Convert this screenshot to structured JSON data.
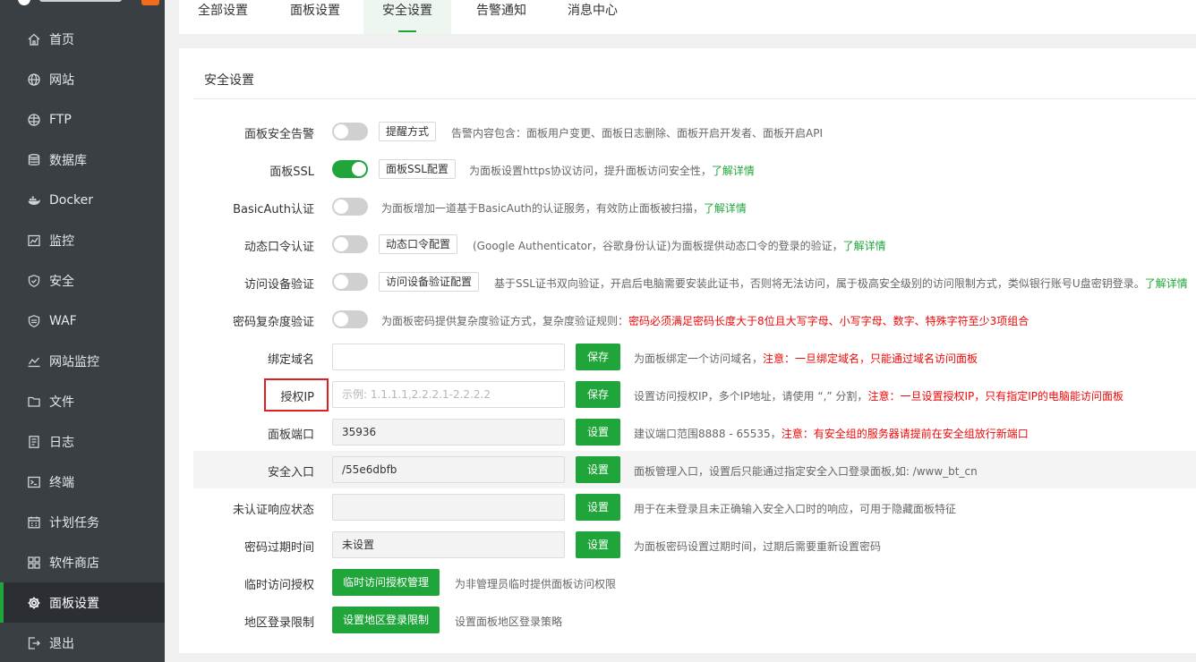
{
  "sidebar": {
    "items": [
      {
        "label": "首页",
        "icon": "home-icon"
      },
      {
        "label": "网站",
        "icon": "globe-icon"
      },
      {
        "label": "FTP",
        "icon": "ftp-globe-icon"
      },
      {
        "label": "数据库",
        "icon": "database-icon"
      },
      {
        "label": "Docker",
        "icon": "docker-icon"
      },
      {
        "label": "监控",
        "icon": "monitor-chart-icon"
      },
      {
        "label": "安全",
        "icon": "shield-check-icon"
      },
      {
        "label": "WAF",
        "icon": "waf-shield-icon"
      },
      {
        "label": "网站监控",
        "icon": "line-chart-icon"
      },
      {
        "label": "文件",
        "icon": "folder-icon"
      },
      {
        "label": "日志",
        "icon": "log-icon"
      },
      {
        "label": "终端",
        "icon": "terminal-icon"
      },
      {
        "label": "计划任务",
        "icon": "calendar-icon"
      },
      {
        "label": "软件商店",
        "icon": "grid-icon"
      },
      {
        "label": "面板设置",
        "icon": "gear-icon",
        "active": true
      },
      {
        "label": "退出",
        "icon": "logout-icon"
      }
    ]
  },
  "tabs": [
    {
      "label": "全部设置"
    },
    {
      "label": "面板设置"
    },
    {
      "label": "安全设置",
      "active": true
    },
    {
      "label": "告警通知"
    },
    {
      "label": "消息中心"
    }
  ],
  "panel": {
    "title": "安全设置",
    "rows": {
      "alert": {
        "label": "面板安全告警",
        "button": "提醒方式",
        "desc": "告警内容包含：面板用户变更、面板日志删除、面板开启开发者、面板开启API"
      },
      "ssl": {
        "label": "面板SSL",
        "button": "面板SSL配置",
        "desc": "为面板设置https协议访问，提升面板访问安全性，",
        "link": "了解详情"
      },
      "basicauth": {
        "label": "BasicAuth认证",
        "desc": "为面板增加一道基于BasicAuth的认证服务，有效防止面板被扫描，",
        "link": "了解详情"
      },
      "otp": {
        "label": "动态口令认证",
        "button": "动态口令配置",
        "desc": "(Google Authenticator，谷歌身份认证)为面板提供动态口令的登录的验证，",
        "link": "了解详情"
      },
      "device": {
        "label": "访问设备验证",
        "button": "访问设备验证配置",
        "desc": "基于SSL证书双向验证，开启后电脑需要安装此证书，否则将无法访问，属于极高安全级别的访问限制方式，类似银行账号U盘密钥登录。",
        "link": "了解详情"
      },
      "pwdcomplex": {
        "label": "密码复杂度验证",
        "desc": "为面板密码提供复杂度验证方式，复杂度验证规则：",
        "warn": "密码必须满足密码长度大于8位且大写字母、小写字母、数字、特殊字符至少3项组合"
      },
      "domain": {
        "label": "绑定域名",
        "value": "",
        "button": "保存",
        "desc": "为面板绑定一个访问域名，",
        "warn": "注意：一旦绑定域名，只能通过域名访问面板"
      },
      "ip": {
        "label": "授权IP",
        "placeholder": "示例: 1.1.1.1,2.2.2.1-2.2.2.2",
        "button": "保存",
        "desc": "设置访问授权IP，多个IP地址，请使用 “,” 分割，",
        "warn": "注意：一旦设置授权IP，只有指定IP的电脑能访问面板"
      },
      "port": {
        "label": "面板端口",
        "value": "35936",
        "button": "设置",
        "desc": "建议端口范围8888 - 65535，",
        "warn": "注意：有安全组的服务器请提前在安全组放行新端口"
      },
      "entry": {
        "label": "安全入口",
        "value": "/55e6dbfb",
        "button": "设置",
        "desc": "面板管理入口，设置后只能通过指定安全入口登录面板,如: /www_bt_cn"
      },
      "unauth": {
        "label": "未认证响应状态",
        "value": "",
        "button": "设置",
        "desc": "用于在未登录且未正确输入安全入口时的响应，可用于隐藏面板特征"
      },
      "pwdexpire": {
        "label": "密码过期时间",
        "value": "未设置",
        "button": "设置",
        "desc": "为面板密码设置过期时间，过期后需要重新设置密码"
      },
      "tempauth": {
        "label": "临时访问授权",
        "button": "临时访问授权管理",
        "desc": "为非管理员临时提供面板访问权限"
      },
      "region": {
        "label": "地区登录限制",
        "button": "设置地区登录限制",
        "desc": "设置面板地区登录策略"
      }
    }
  },
  "colors": {
    "sidebar_bg": "#3a3f44",
    "accent_green": "#20a53a",
    "warn_red": "#ef0808",
    "highlight_box": "#e02020"
  }
}
